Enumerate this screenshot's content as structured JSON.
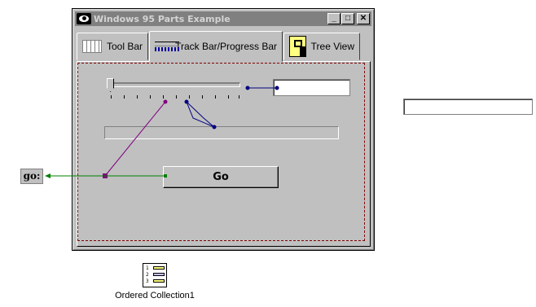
{
  "window": {
    "title": "Windows 95 Parts Example",
    "buttons": {
      "minimize": "_",
      "maximize": "□",
      "close": "✕"
    }
  },
  "tabs": [
    {
      "label": "Tool Bar",
      "icon": "toolbar-icon"
    },
    {
      "label": "Track Bar/Progress Bar",
      "icon": "trackbar-icon"
    },
    {
      "label": "Tree View",
      "icon": "treeview-icon"
    }
  ],
  "panel": {
    "go_button": "Go",
    "trackbar_text": "",
    "progress_value": 0
  },
  "external": {
    "go_label": "go:",
    "text_field": ""
  },
  "collection": {
    "label": "Ordered Collection1",
    "icon": "ordered-collection-icon"
  },
  "colors": {
    "face": "#c0c0c0",
    "titlebar_inactive": "#808080",
    "link_magenta": "#800080",
    "link_navy": "#000080",
    "link_green": "#008000",
    "dashed_border": "#800000"
  }
}
